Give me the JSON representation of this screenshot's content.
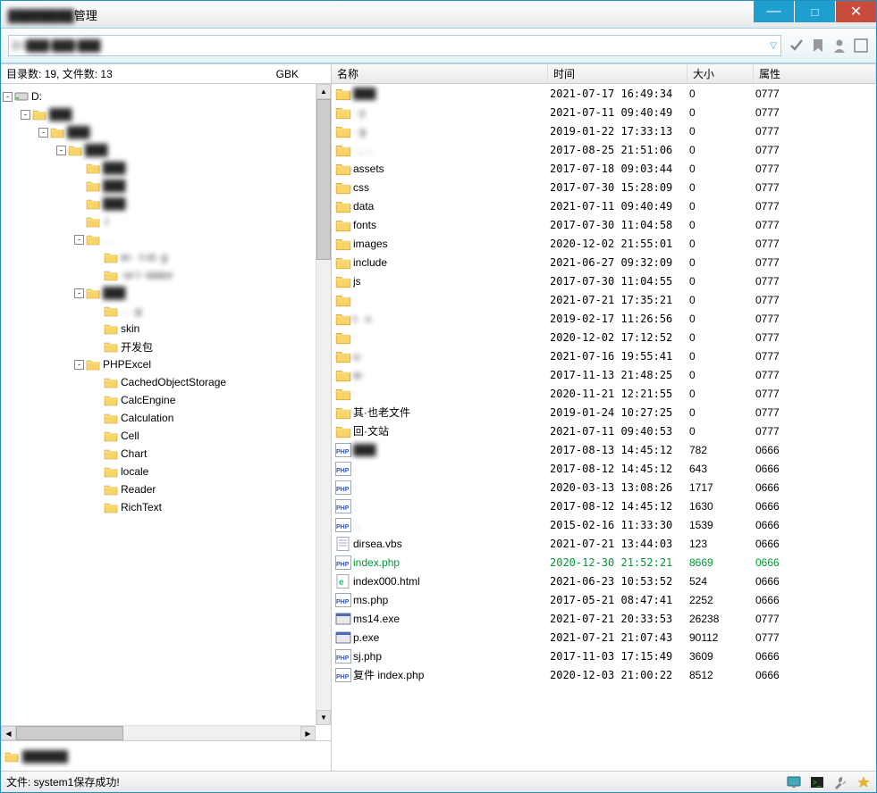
{
  "window": {
    "title_suffix": "管理"
  },
  "left_head": {
    "dir_label": "目录数:",
    "dir_count": "19,",
    "file_label": "文件数:",
    "file_count": "13",
    "encoding": "GBK"
  },
  "tree": {
    "drive": "D:",
    "nodes": [
      {
        "indent": 1,
        "toggle": "-",
        "label": "",
        "blur": true
      },
      {
        "indent": 2,
        "toggle": "-",
        "label": "",
        "blur": true
      },
      {
        "indent": 3,
        "toggle": "-",
        "label": "",
        "blur": true
      },
      {
        "indent": 4,
        "toggle": "",
        "label": "",
        "blur": true
      },
      {
        "indent": 4,
        "toggle": "",
        "label": "",
        "blur": true
      },
      {
        "indent": 4,
        "toggle": "",
        "label": "",
        "blur": true
      },
      {
        "indent": 4,
        "toggle": "",
        "label": ".l",
        "blur": true
      },
      {
        "indent": 4,
        "toggle": "-",
        "label": ". .",
        "blur": true
      },
      {
        "indent": 5,
        "toggle": "",
        "label": "er· ·t·el. g",
        "blur": true
      },
      {
        "indent": 5,
        "toggle": "",
        "label": "·or·l ·idator",
        "blur": true
      },
      {
        "indent": 4,
        "toggle": "-",
        "label": "",
        "blur": true
      },
      {
        "indent": 5,
        "toggle": "",
        "label": ". . .g",
        "blur": true
      },
      {
        "indent": 5,
        "toggle": "",
        "label": "skin",
        "blur": false
      },
      {
        "indent": 5,
        "toggle": "",
        "label": "开发包",
        "blur": false
      },
      {
        "indent": 4,
        "toggle": "-",
        "label": "PHPExcel",
        "blur": false
      },
      {
        "indent": 5,
        "toggle": "",
        "label": "CachedObjectStorage",
        "blur": false
      },
      {
        "indent": 5,
        "toggle": "",
        "label": "CalcEngine",
        "blur": false
      },
      {
        "indent": 5,
        "toggle": "",
        "label": "Calculation",
        "blur": false
      },
      {
        "indent": 5,
        "toggle": "",
        "label": "Cell",
        "blur": false
      },
      {
        "indent": 5,
        "toggle": "",
        "label": "Chart",
        "blur": false
      },
      {
        "indent": 5,
        "toggle": "",
        "label": "locale",
        "blur": false
      },
      {
        "indent": 5,
        "toggle": "",
        "label": "Reader",
        "blur": false
      },
      {
        "indent": 5,
        "toggle": "",
        "label": "RichText",
        "blur": false
      }
    ]
  },
  "columns": {
    "name": "名称",
    "time": "时间",
    "size": "大小",
    "attr": "属性"
  },
  "files": [
    {
      "type": "folder",
      "name": "",
      "blur": true,
      "time": "2021-07-17 16:49:34",
      "size": "0",
      "attr": "0777"
    },
    {
      "type": "folder",
      "name": "·    y",
      "blur": true,
      "time": "2021-07-11 09:40:49",
      "size": "0",
      "attr": "0777"
    },
    {
      "type": "folder",
      "name": "·   g",
      "blur": true,
      "time": "2019-01-22 17:33:13",
      "size": "0",
      "attr": "0777"
    },
    {
      "type": "folder",
      "name": "·    ,  ·.",
      "blur": true,
      "time": "2017-08-25 21:51:06",
      "size": "0",
      "attr": "0777"
    },
    {
      "type": "folder",
      "name": "assets",
      "blur": false,
      "time": "2017-07-18 09:03:44",
      "size": "0",
      "attr": "0777"
    },
    {
      "type": "folder",
      "name": "css",
      "blur": false,
      "time": "2017-07-30 15:28:09",
      "size": "0",
      "attr": "0777"
    },
    {
      "type": "folder",
      "name": "data",
      "blur": false,
      "time": "2021-07-11 09:40:49",
      "size": "0",
      "attr": "0777"
    },
    {
      "type": "folder",
      "name": "fonts",
      "blur": false,
      "time": "2017-07-30 11:04:58",
      "size": "0",
      "attr": "0777"
    },
    {
      "type": "folder",
      "name": "images",
      "blur": false,
      "time": "2020-12-02 21:55:01",
      "size": "0",
      "attr": "0777"
    },
    {
      "type": "folder",
      "name": "include",
      "blur": false,
      "time": "2021-06-27 09:32:09",
      "size": "0",
      "attr": "0777"
    },
    {
      "type": "folder",
      "name": "js",
      "blur": false,
      "time": "2017-07-30 11:04:55",
      "size": "0",
      "attr": "0777"
    },
    {
      "type": "folder",
      "name": "·",
      "blur": true,
      "time": "2021-07-21 17:35:21",
      "size": "0",
      "attr": "0777"
    },
    {
      "type": "folder",
      "name": "t·  ·c",
      "blur": true,
      "time": "2019-02-17 11:26:56",
      "size": "0",
      "attr": "0777"
    },
    {
      "type": "folder",
      "name": "·",
      "blur": true,
      "time": "2020-12-02 17:12:52",
      "size": "0",
      "attr": "0777"
    },
    {
      "type": "folder",
      "name": "u·",
      "blur": true,
      "time": "2021-07-16 19:55:41",
      "size": "0",
      "attr": "0777"
    },
    {
      "type": "folder",
      "name": "w·",
      "blur": true,
      "time": "2017-11-13 21:48:25",
      "size": "0",
      "attr": "0777"
    },
    {
      "type": "folder",
      "name": "·",
      "blur": true,
      "time": "2020-11-21 12:21:55",
      "size": "0",
      "attr": "0777"
    },
    {
      "type": "folder",
      "name": "其·也老文件",
      "blur": false,
      "time": "2019-01-24 10:27:25",
      "size": "0",
      "attr": "0777"
    },
    {
      "type": "folder",
      "name": "回·文站",
      "blur": false,
      "time": "2021-07-11 09:40:53",
      "size": "0",
      "attr": "0777"
    },
    {
      "type": "php",
      "name": "",
      "blur": true,
      "time": "2017-08-13 14:45:12",
      "size": "782",
      "attr": "0666"
    },
    {
      "type": "php",
      "name": "·",
      "blur": true,
      "time": "2017-08-12 14:45:12",
      "size": "643",
      "attr": "0666"
    },
    {
      "type": "php",
      "name": "·",
      "blur": true,
      "time": "2020-03-13 13:08:26",
      "size": "1717",
      "attr": "0666"
    },
    {
      "type": "php",
      "name": "·",
      "blur": true,
      "time": "2017-08-12 14:45:12",
      "size": "1630",
      "attr": "0666"
    },
    {
      "type": "php",
      "name": "·.",
      "blur": true,
      "time": "2015-02-16 11:33:30",
      "size": "1539",
      "attr": "0666"
    },
    {
      "type": "vbs",
      "name": "dirsea.vbs",
      "blur": false,
      "time": "2021-07-21 13:44:03",
      "size": "123",
      "attr": "0666"
    },
    {
      "type": "php",
      "name": "index.php",
      "blur": false,
      "time": "2020-12-30 21:52:21",
      "size": "8669",
      "attr": "0666",
      "hl": true
    },
    {
      "type": "html",
      "name": "index000.html",
      "blur": false,
      "time": "2021-06-23 10:53:52",
      "size": "524",
      "attr": "0666"
    },
    {
      "type": "php",
      "name": "ms.php",
      "blur": false,
      "time": "2017-05-21 08:47:41",
      "size": "2252",
      "attr": "0666"
    },
    {
      "type": "exe",
      "name": "ms14.exe",
      "blur": false,
      "time": "2021-07-21 20:33:53",
      "size": "26238",
      "attr": "0777"
    },
    {
      "type": "exe",
      "name": "p.exe",
      "blur": false,
      "time": "2021-07-21 21:07:43",
      "size": "90112",
      "attr": "0777"
    },
    {
      "type": "php",
      "name": "sj.php",
      "blur": false,
      "time": "2017-11-03 17:15:49",
      "size": "3609",
      "attr": "0666"
    },
    {
      "type": "php",
      "name": "复件 index.php",
      "blur": false,
      "time": "2020-12-03 21:00:22",
      "size": "8512",
      "attr": "0666"
    }
  ],
  "status": {
    "text": "文件: system1保存成功!"
  }
}
